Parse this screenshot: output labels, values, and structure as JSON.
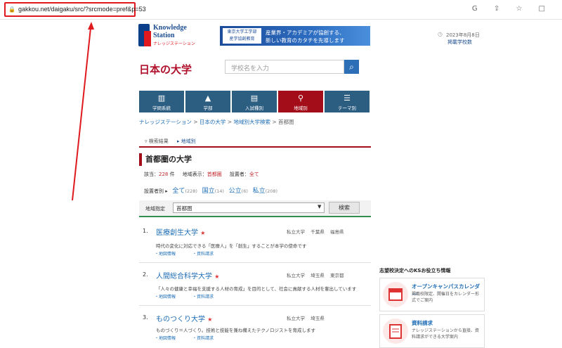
{
  "browser": {
    "url": "gakkou.net/daigaku/src/?srcmode=pref&p=53"
  },
  "header": {
    "logo_line1": "Knowledge",
    "logo_line2": "Station",
    "logo_sub": "ナレッジステーション",
    "banner_left": "東京大学工学部\n産学協創教育",
    "banner_right1": "産業界・アカデミアが協創する、",
    "banner_right2": "新しい教育のカタチを先導します",
    "date": "2023年8月8日",
    "date_link": "掲載学校数",
    "site_title": "日本の大学",
    "search_placeholder": "学校名を入力"
  },
  "nav": [
    {
      "label": "学問系統",
      "icon": "books-icon"
    },
    {
      "label": "学部",
      "icon": "cap-icon"
    },
    {
      "label": "入試種別",
      "icon": "book-icon"
    },
    {
      "label": "地域別",
      "icon": "map-icon",
      "active": true
    },
    {
      "label": "テーマ別",
      "icon": "list-icon"
    }
  ],
  "breadcrumb": [
    "ナレッジステーション",
    "日本の大学",
    "地域別大学検索",
    "首都圏"
  ],
  "tabs": {
    "t1": "検索結果",
    "t2": "地域別"
  },
  "page": {
    "heading": "首都圏の大学",
    "count_label": "該当：",
    "count": "228",
    "count_unit": "件",
    "region_label": "地域表示：",
    "region": "首都圏",
    "founder_label": "設置者：",
    "founder": "全て",
    "filter_label": "設置者別",
    "filters": [
      {
        "label": "全て",
        "n": "(228)"
      },
      {
        "label": "国立",
        "n": "(14)"
      },
      {
        "label": "公立",
        "n": "(6)"
      },
      {
        "label": "私立",
        "n": "(208)"
      }
    ],
    "area_label": "地域指定",
    "area_value": "首都圏",
    "search_button": "検索"
  },
  "results": [
    {
      "num": "1.",
      "name": "医療創生大学",
      "type": "私立大学",
      "pref": "千葉県",
      "pref2": "福島県",
      "desc": "時代の変化に対応できる「医療人」を「創生」することが本学の使命です"
    },
    {
      "num": "2.",
      "name": "人間総合科学大学",
      "type": "私立大学",
      "pref": "埼玉県",
      "pref2": "東京都",
      "desc": "「人々の健康と幸福を支援する人材の育成」を目的として、社会に貢献する人材を輩出しています"
    },
    {
      "num": "3.",
      "name": "ものつくり大学",
      "type": "私立大学",
      "pref": "埼玉県",
      "pref2": "",
      "desc": "ものづくり＝人づくり。技術と技能を兼ね備えたテクノロジストを育成します"
    }
  ],
  "link_map": "地図情報",
  "link_doc": "資料請求",
  "star": "★",
  "sidebar": {
    "heading": "志望校決定へのKSお役立ち情報",
    "cards": [
      {
        "title": "オープンキャンパスカレンダー",
        "desc": "掲載校限定、開催日をカレンダー形式でご案内",
        "icon": "calendar-icon"
      },
      {
        "title": "資料請求",
        "desc": "ナレッジステーションから直接、資料請求ができる大学案内",
        "icon": "document-icon"
      }
    ]
  }
}
